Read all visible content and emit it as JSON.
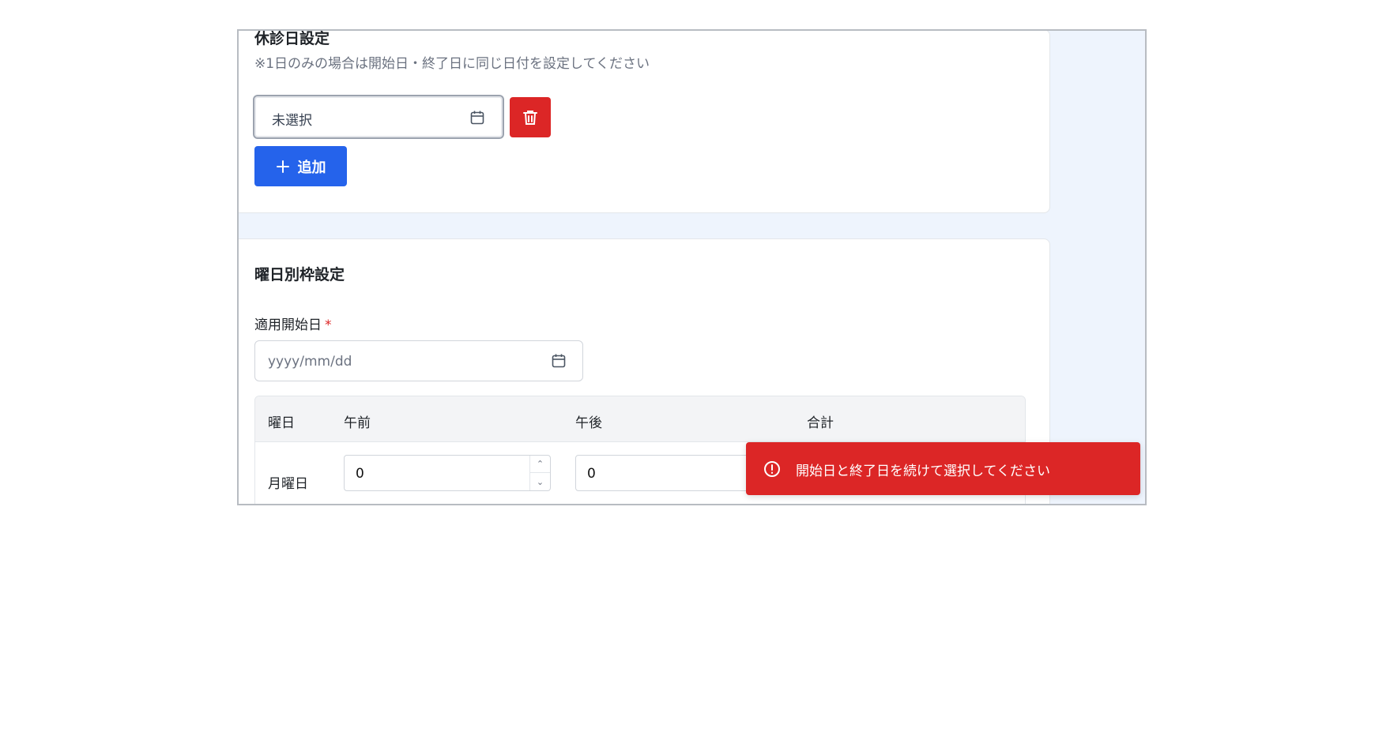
{
  "holiday": {
    "title": "休診日設定",
    "note": "※1日のみの場合は開始日・終了日に同じ日付を設定してください",
    "date_value": "未選択",
    "add_label": "追加"
  },
  "weekday": {
    "title": "曜日別枠設定",
    "start_label": "適用開始日",
    "required_mark": "*",
    "date_placeholder": "yyyy/mm/dd",
    "table": {
      "headers": [
        "曜日",
        "午前",
        "午後",
        "合計"
      ],
      "rows": [
        {
          "day": "月曜日",
          "am": "0",
          "pm": "0"
        }
      ]
    }
  },
  "toast": {
    "message": "開始日と終了日を続けて選択してください"
  },
  "colors": {
    "primary": "#2563eb",
    "danger": "#dc2626",
    "background": "#eef4fd"
  },
  "icons": [
    "calendar-icon",
    "trash-icon",
    "plus-icon",
    "chevron-up-icon",
    "chevron-down-icon",
    "alert-circle-icon"
  ]
}
